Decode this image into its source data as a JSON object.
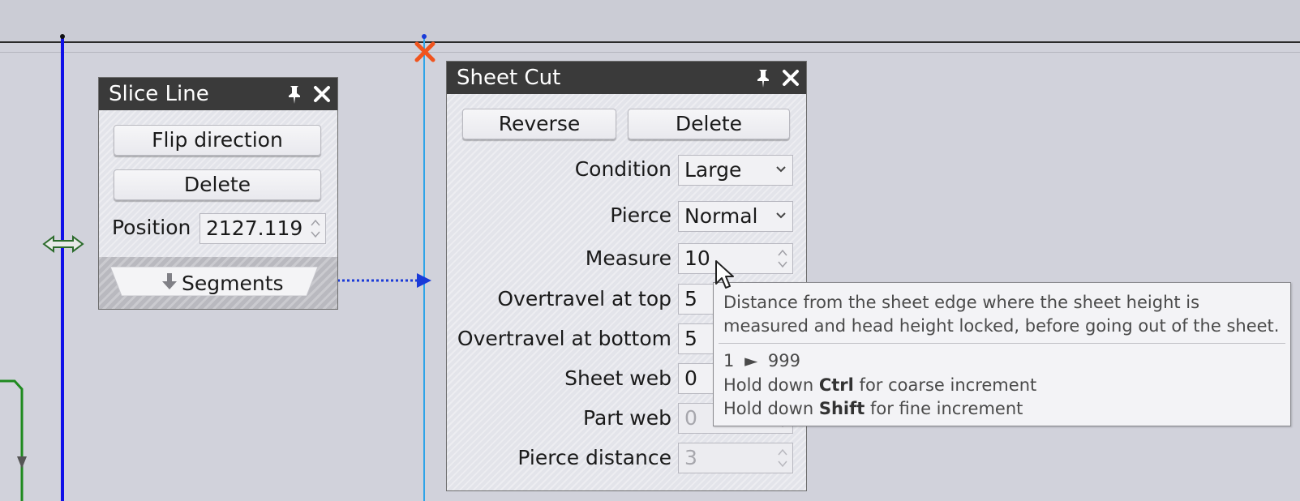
{
  "slice_line": {
    "title": "Slice Line",
    "flip_label": "Flip direction",
    "delete_label": "Delete",
    "position_label": "Position",
    "position_value": "2127.119",
    "segments_label": "Segments"
  },
  "sheet_cut": {
    "title": "Sheet Cut",
    "reverse_label": "Reverse",
    "delete_label": "Delete",
    "rows": [
      {
        "label": "Condition",
        "value": "Large"
      },
      {
        "label": "Pierce",
        "value": "Normal"
      },
      {
        "label": "Measure",
        "value": "10"
      },
      {
        "label": "Overtravel at top",
        "value": "5"
      },
      {
        "label": "Overtravel at bottom",
        "value": "5"
      },
      {
        "label": "Sheet web",
        "value": "0"
      },
      {
        "label": "Part web",
        "value": "0"
      },
      {
        "label": "Pierce distance",
        "value": "3"
      }
    ]
  },
  "tooltip": {
    "description": "Distance from the sheet edge where the sheet height is measured and head height locked, before going out of the sheet.",
    "range_min": "1",
    "range_arrow": "►",
    "range_max": "999",
    "coarse_pre": "Hold down",
    "coarse_key": "Ctrl",
    "coarse_post": "for coarse increment",
    "fine_pre": "Hold down",
    "fine_key": "Shift",
    "fine_post": "for fine increment"
  },
  "colors": {
    "slice_line": "#1010e8",
    "sheet_cut_line": "#2ea4e8",
    "cut_marker": "#f0541e",
    "panel_title_bg": "#3a3a3a",
    "link_arrow": "#1a3ad8"
  },
  "icons": [
    "pin-icon",
    "close-icon",
    "down-arrow-icon",
    "spin-arrows-icon",
    "dropdown-chevron-icon",
    "resize-arrow-icon",
    "cut-marker-icon",
    "mouse-cursor-icon"
  ]
}
